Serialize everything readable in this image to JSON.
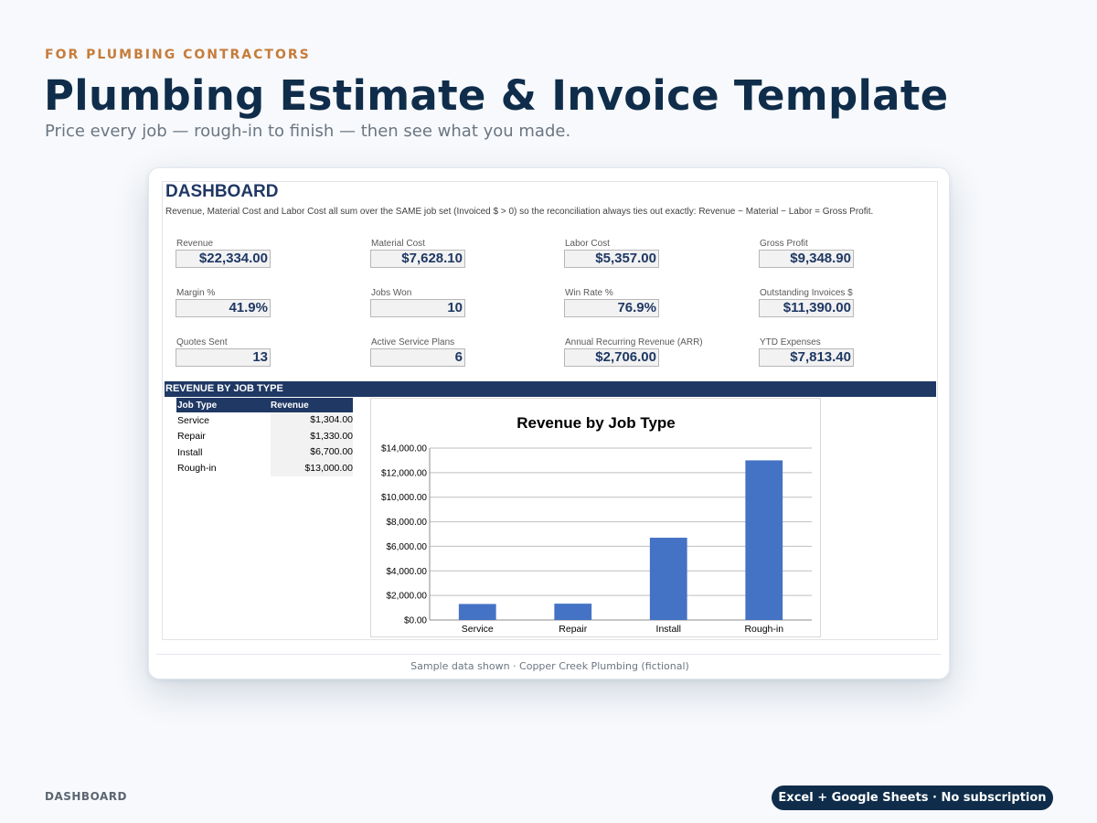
{
  "hero": {
    "eyebrow": "FOR PLUMBING CONTRACTORS",
    "title": "Plumbing Estimate & Invoice Template",
    "subtitle": "Price every job — rough-in to finish — then see what you made."
  },
  "sheet": {
    "title": "DASHBOARD",
    "note": "Revenue, Material Cost and Labor Cost all sum over the SAME job set (Invoiced $ > 0) so the reconciliation always ties out exactly: Revenue − Material − Labor = Gross Profit.",
    "kpis": [
      {
        "label": "Revenue",
        "value": "$22,334.00"
      },
      {
        "label": "Material Cost",
        "value": "$7,628.10"
      },
      {
        "label": "Labor Cost",
        "value": "$5,357.00"
      },
      {
        "label": "Gross Profit",
        "value": "$9,348.90"
      },
      {
        "label": "Margin %",
        "value": "41.9%"
      },
      {
        "label": "Jobs Won",
        "value": "10"
      },
      {
        "label": "Win Rate %",
        "value": "76.9%"
      },
      {
        "label": "Outstanding Invoices $",
        "value": "$11,390.00"
      },
      {
        "label": "Quotes Sent",
        "value": "13"
      },
      {
        "label": "Active Service Plans",
        "value": "6"
      },
      {
        "label": "Annual Recurring Revenue (ARR)",
        "value": "$2,706.00"
      },
      {
        "label": "YTD Expenses",
        "value": "$7,813.40"
      }
    ],
    "section_title": "REVENUE BY JOB TYPE",
    "table": {
      "headers": [
        "Job Type",
        "Revenue"
      ],
      "rows": [
        [
          "Service",
          "$1,304.00"
        ],
        [
          "Repair",
          "$1,330.00"
        ],
        [
          "Install",
          "$6,700.00"
        ],
        [
          "Rough-in",
          "$13,000.00"
        ]
      ]
    }
  },
  "chart_data": {
    "type": "bar",
    "title": "Revenue by Job Type",
    "categories": [
      "Service",
      "Repair",
      "Install",
      "Rough-in"
    ],
    "values": [
      1304,
      1330,
      6700,
      13000
    ],
    "ylim": [
      0,
      14000
    ],
    "yticks": [
      "$0.00",
      "$2,000.00",
      "$4,000.00",
      "$6,000.00",
      "$8,000.00",
      "$10,000.00",
      "$12,000.00",
      "$14,000.00"
    ],
    "grid": true,
    "bar_color": "#4472c4"
  },
  "card_footer": "Sample data shown · Copper Creek Plumbing (fictional)",
  "footer": {
    "left": "DASHBOARD",
    "pill": "Excel + Google Sheets · No subscription"
  },
  "colors": {
    "navy": "#0f2d4a",
    "accent": "#c67c3a",
    "sheet_header": "#1f3864"
  }
}
